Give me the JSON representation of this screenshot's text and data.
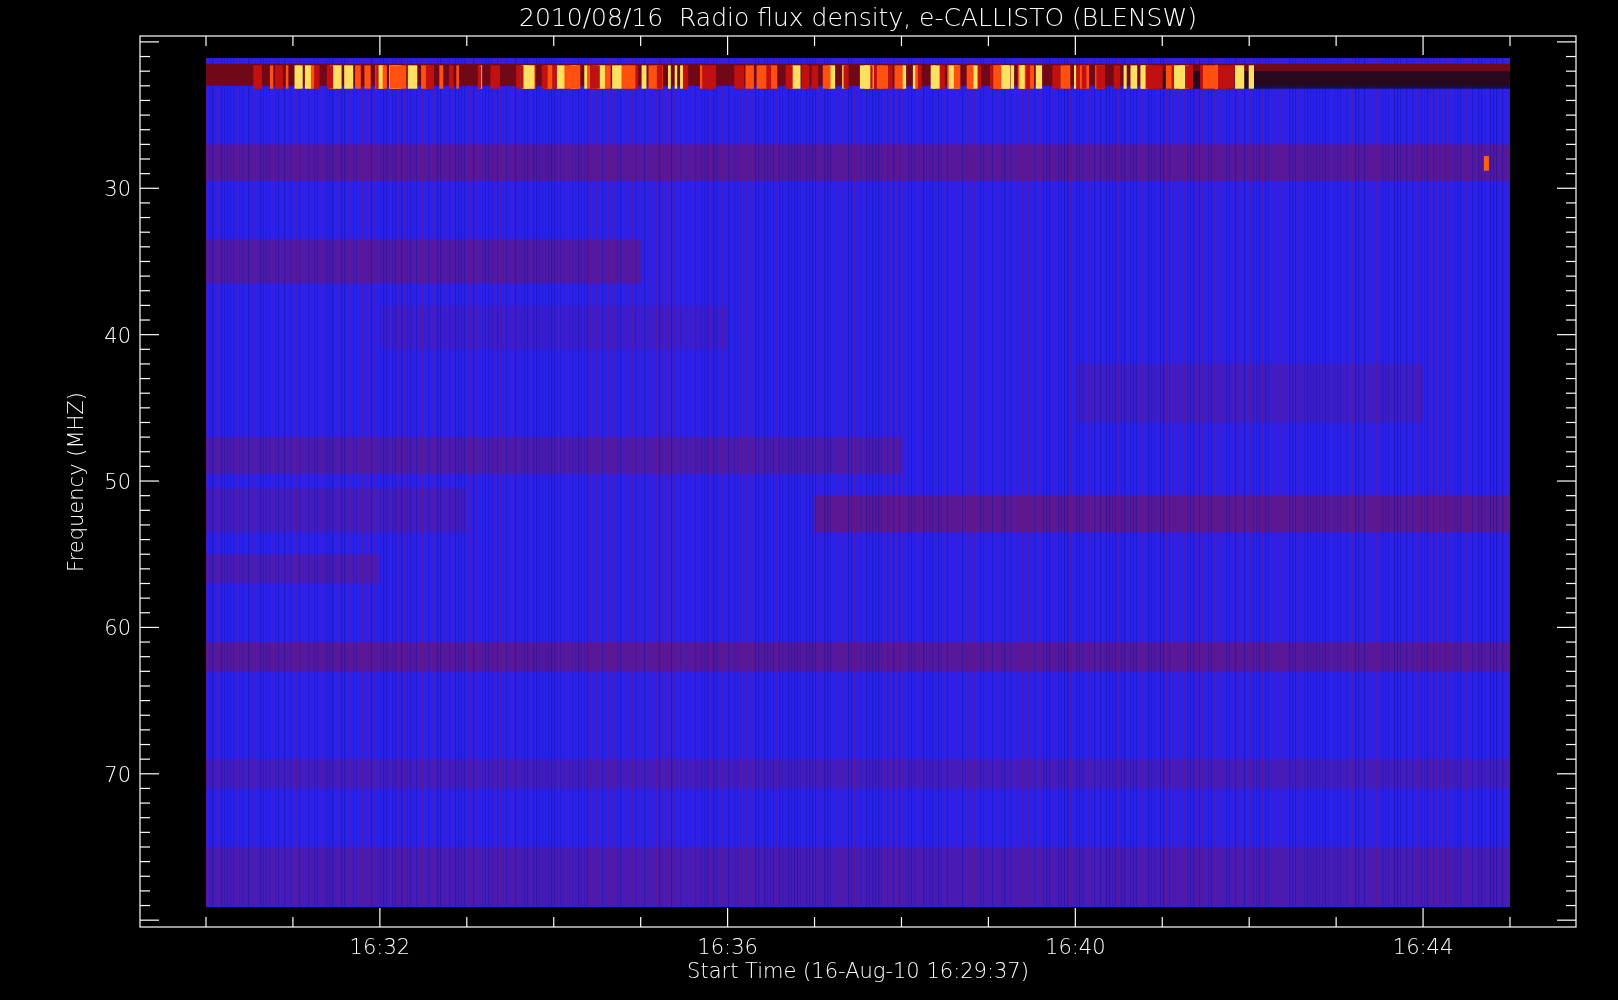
{
  "title": "2010/08/16  Radio flux density, e-CALLISTO (BLENSW)",
  "x_axis": {
    "label": "Start Time (16-Aug-10 16:29:37)",
    "ticks": [
      "16:32",
      "16:36",
      "16:40",
      "16:44"
    ]
  },
  "y_axis": {
    "label": "Frequency (MHZ)",
    "ticks": [
      "30",
      "40",
      "50",
      "60",
      "70"
    ]
  }
}
